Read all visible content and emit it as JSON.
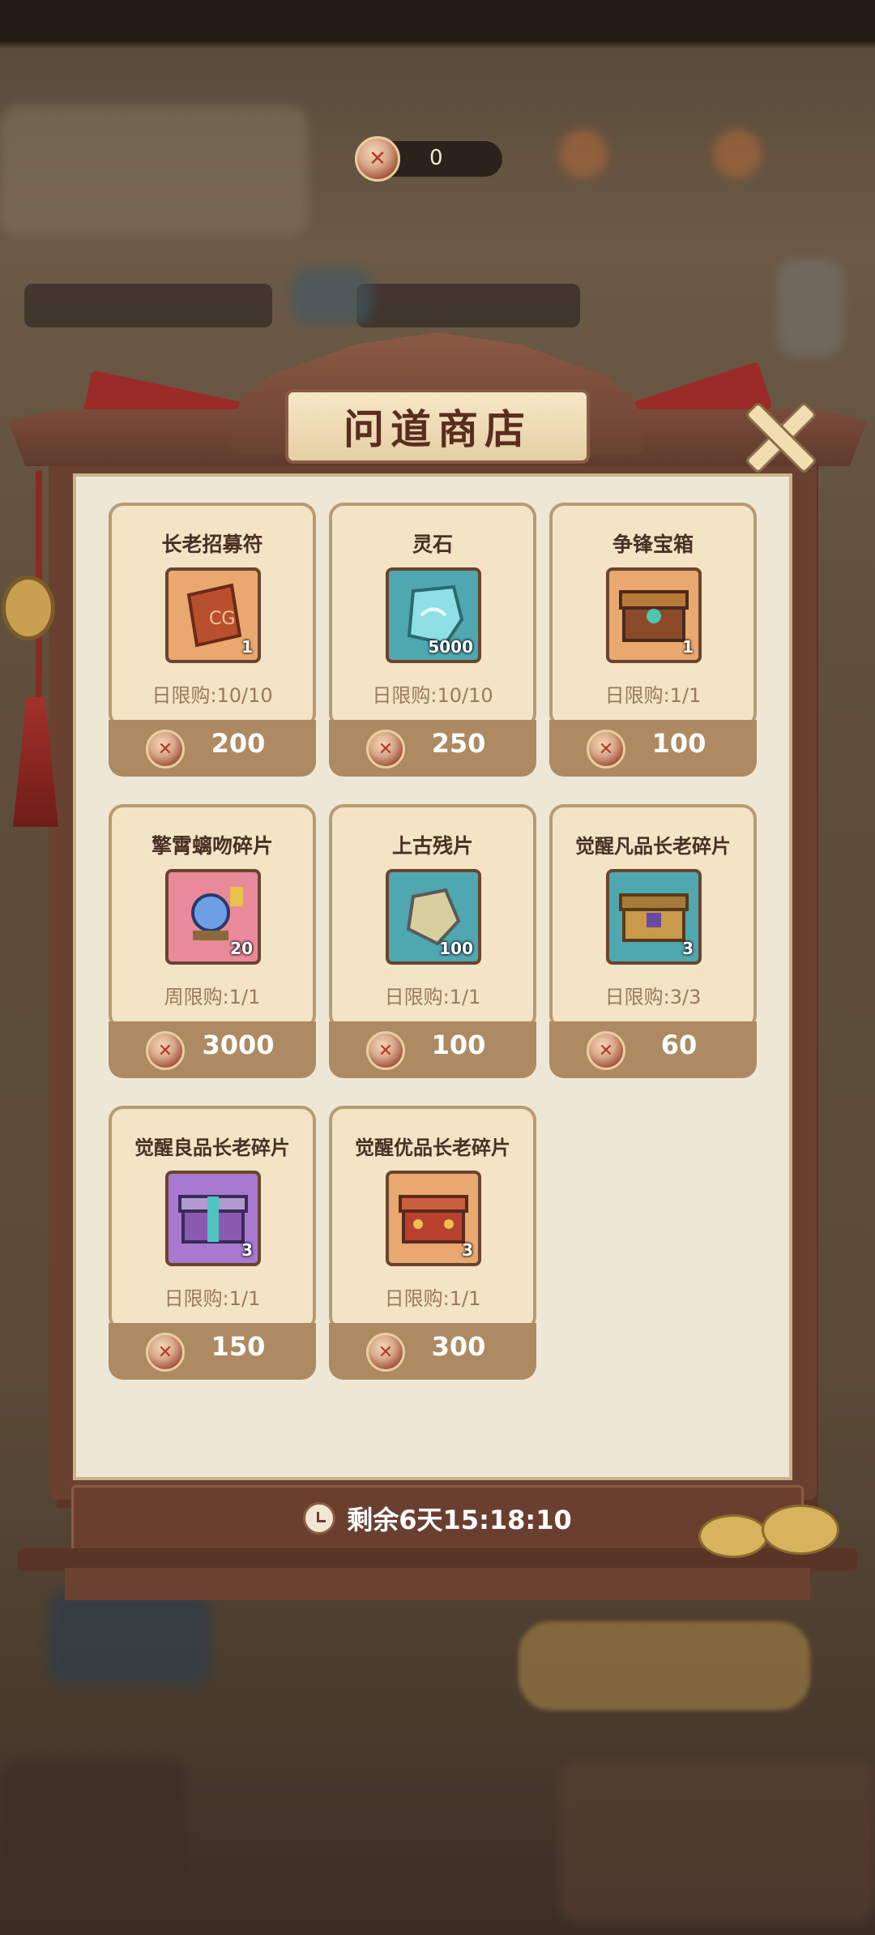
{
  "currency": {
    "icon": "crossed-swords-coin-icon",
    "value": "0"
  },
  "shop": {
    "title": "问道商店",
    "items": [
      {
        "name": "长老招募符",
        "quantity": "1",
        "limit": "日限购:10/10",
        "price": "200",
        "icon": "recruit-talisman-icon"
      },
      {
        "name": "灵石",
        "quantity": "5000",
        "limit": "日限购:10/10",
        "price": "250",
        "icon": "spirit-stone-icon"
      },
      {
        "name": "争锋宝箱",
        "quantity": "1",
        "limit": "日限购:1/1",
        "price": "100",
        "icon": "treasure-chest-icon"
      },
      {
        "name": "擎霄螭吻碎片",
        "quantity": "20",
        "limit": "周限购:1/1",
        "price": "3000",
        "icon": "dragon-shard-icon"
      },
      {
        "name": "上古残片",
        "quantity": "100",
        "limit": "日限购:1/1",
        "price": "100",
        "icon": "ancient-fragment-icon"
      },
      {
        "name": "觉醒凡品长老碎片",
        "quantity": "3",
        "limit": "日限购:3/3",
        "price": "60",
        "icon": "common-elder-chest-icon"
      },
      {
        "name": "觉醒良品长老碎片",
        "quantity": "3",
        "limit": "日限购:1/1",
        "price": "150",
        "icon": "good-elder-chest-icon"
      },
      {
        "name": "觉醒优品长老碎片",
        "quantity": "3",
        "limit": "日限购:1/1",
        "price": "300",
        "icon": "excellent-elder-chest-icon"
      }
    ],
    "timer": "剩余6天15:18:10"
  },
  "colors": {
    "frame": "#6a4030",
    "card": "#f2e4c5",
    "card_foot": "#ad8a62",
    "title": "#5a2d20"
  }
}
